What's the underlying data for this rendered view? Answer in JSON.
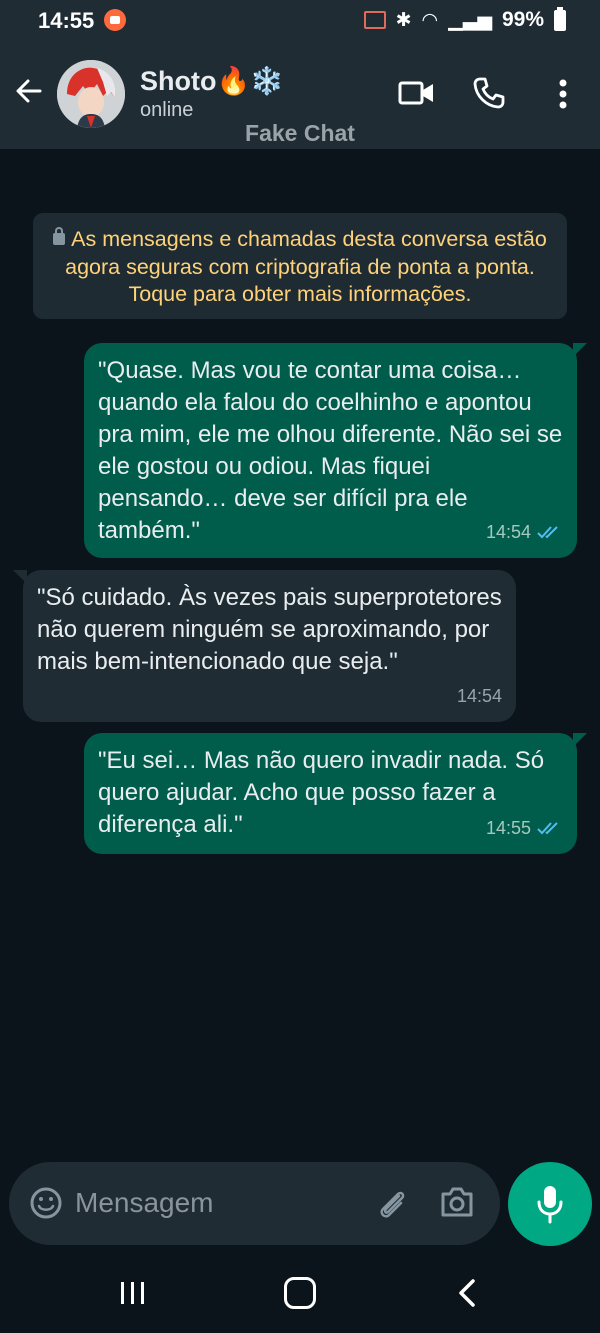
{
  "status_bar": {
    "time": "14:55",
    "battery": "99%"
  },
  "header": {
    "contact_name": "Shoto🔥❄️",
    "contact_status": "online",
    "watermark": "Fake Chat"
  },
  "notice": {
    "text": "As mensagens e chamadas desta conversa estão agora seguras com criptografia de ponta a ponta. Toque para obter mais informações."
  },
  "messages": [
    {
      "direction": "out",
      "text": "\"Quase. Mas vou te contar uma coisa… quando ela falou do coelhinho e apontou pra mim, ele me olhou diferente. Não sei se ele gostou ou odiou. Mas fiquei pensando… deve ser difícil pra ele também.\"",
      "time": "14:54",
      "read": true
    },
    {
      "direction": "in",
      "text": "\"Só cuidado. Às vezes pais superprotetores não querem ninguém se aproximando, por mais bem-intencionado que seja.\"",
      "time": "14:54"
    },
    {
      "direction": "out",
      "text": "\"Eu sei… Mas não quero invadir nada. Só quero ajudar. Acho que posso fazer a diferença ali.\"",
      "time": "14:55",
      "read": true
    }
  ],
  "composer": {
    "placeholder": "Mensagem"
  },
  "colors": {
    "header_bg": "#1f2c34",
    "chat_bg": "#0b141a",
    "outgoing_bubble": "#005c4b",
    "incoming_bubble": "#1f2c34",
    "accent": "#00a884",
    "notice_text": "#ffd279",
    "read_ticks": "#53bdeb"
  },
  "icons": [
    "back-arrow-icon",
    "video-call-icon",
    "phone-call-icon",
    "more-options-icon",
    "emoji-icon",
    "attach-icon",
    "camera-icon",
    "mic-icon",
    "lock-icon",
    "double-check-icon"
  ]
}
